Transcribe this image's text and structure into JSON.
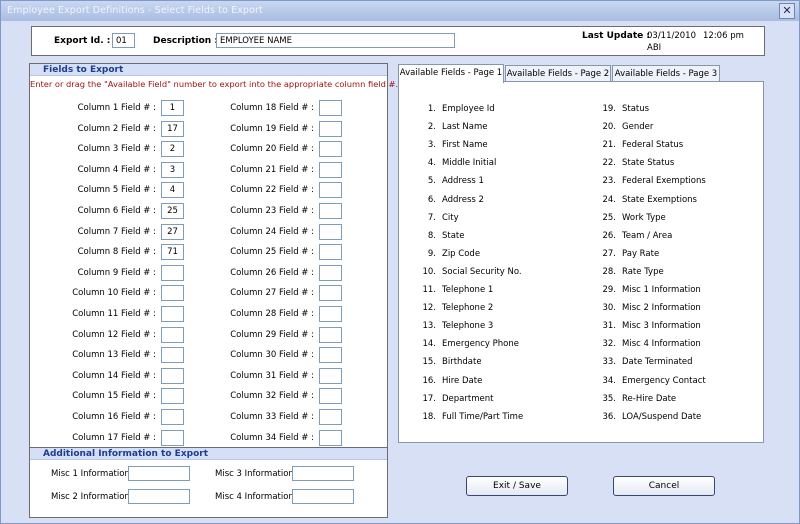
{
  "window": {
    "title": "Employee Export Definitions - Select Fields to Export",
    "close_glyph": "✕"
  },
  "header": {
    "export_id_label": "Export Id. :",
    "export_id_value": "01",
    "description_label": "Description :",
    "description_value": "EMPLOYEE NAME",
    "last_update_label": "Last Update :",
    "last_update_date": "03/11/2010",
    "last_update_time": "12:06 pm",
    "last_update_user": "ABI"
  },
  "fields_to_export": {
    "title": "Fields to Export",
    "instruction": "Enter or drag the \"Available Field\" number to export into the appropriate column field #.",
    "left_columns": [
      {
        "label": "Column 1 Field # :",
        "value": "1"
      },
      {
        "label": "Column 2 Field # :",
        "value": "17"
      },
      {
        "label": "Column 3 Field # :",
        "value": "2"
      },
      {
        "label": "Column 4 Field # :",
        "value": "3"
      },
      {
        "label": "Column 5 Field # :",
        "value": "4"
      },
      {
        "label": "Column 6 Field # :",
        "value": "25"
      },
      {
        "label": "Column 7 Field # :",
        "value": "27"
      },
      {
        "label": "Column 8 Field # :",
        "value": "71"
      },
      {
        "label": "Column 9 Field # :",
        "value": ""
      },
      {
        "label": "Column 10 Field # :",
        "value": ""
      },
      {
        "label": "Column 11 Field # :",
        "value": ""
      },
      {
        "label": "Column 12 Field # :",
        "value": ""
      },
      {
        "label": "Column 13 Field # :",
        "value": ""
      },
      {
        "label": "Column 14 Field # :",
        "value": ""
      },
      {
        "label": "Column 15 Field # :",
        "value": ""
      },
      {
        "label": "Column 16 Field # :",
        "value": ""
      },
      {
        "label": "Column 17 Field # :",
        "value": ""
      }
    ],
    "right_columns": [
      {
        "label": "Column 18 Field # :",
        "value": ""
      },
      {
        "label": "Column 19 Field # :",
        "value": ""
      },
      {
        "label": "Column 20 Field # :",
        "value": ""
      },
      {
        "label": "Column 21 Field # :",
        "value": ""
      },
      {
        "label": "Column 22 Field # :",
        "value": ""
      },
      {
        "label": "Column 23 Field # :",
        "value": ""
      },
      {
        "label": "Column 24 Field # :",
        "value": ""
      },
      {
        "label": "Column 25 Field # :",
        "value": ""
      },
      {
        "label": "Column 26 Field # :",
        "value": ""
      },
      {
        "label": "Column 27 Field # :",
        "value": ""
      },
      {
        "label": "Column 28 Field # :",
        "value": ""
      },
      {
        "label": "Column 29 Field # :",
        "value": ""
      },
      {
        "label": "Column 30 Field # :",
        "value": ""
      },
      {
        "label": "Column 31 Field # :",
        "value": ""
      },
      {
        "label": "Column 32 Field # :",
        "value": ""
      },
      {
        "label": "Column 33 Field # :",
        "value": ""
      },
      {
        "label": "Column 34 Field # :",
        "value": ""
      }
    ]
  },
  "tabs": [
    "Available Fields - Page 1",
    "Available Fields - Page 2",
    "Available Fields - Page 3"
  ],
  "available_fields": {
    "left": [
      {
        "num": "1.",
        "name": "Employee Id"
      },
      {
        "num": "2.",
        "name": "Last Name"
      },
      {
        "num": "3.",
        "name": "First Name"
      },
      {
        "num": "4.",
        "name": "Middle Initial"
      },
      {
        "num": "5.",
        "name": "Address 1"
      },
      {
        "num": "6.",
        "name": "Address 2"
      },
      {
        "num": "7.",
        "name": "City"
      },
      {
        "num": "8.",
        "name": "State"
      },
      {
        "num": "9.",
        "name": "Zip Code"
      },
      {
        "num": "10.",
        "name": "Social Security No."
      },
      {
        "num": "11.",
        "name": "Telephone 1"
      },
      {
        "num": "12.",
        "name": "Telephone 2"
      },
      {
        "num": "13.",
        "name": "Telephone 3"
      },
      {
        "num": "14.",
        "name": "Emergency Phone"
      },
      {
        "num": "15.",
        "name": "Birthdate"
      },
      {
        "num": "16.",
        "name": "Hire Date"
      },
      {
        "num": "17.",
        "name": "Department"
      },
      {
        "num": "18.",
        "name": "Full Time/Part Time"
      }
    ],
    "right": [
      {
        "num": "19.",
        "name": "Status"
      },
      {
        "num": "20.",
        "name": "Gender"
      },
      {
        "num": "21.",
        "name": "Federal Status"
      },
      {
        "num": "22.",
        "name": "State Status"
      },
      {
        "num": "23.",
        "name": "Federal Exemptions"
      },
      {
        "num": "24.",
        "name": "State Exemptions"
      },
      {
        "num": "25.",
        "name": "Work Type"
      },
      {
        "num": "26.",
        "name": "Team / Area"
      },
      {
        "num": "27.",
        "name": "Pay Rate"
      },
      {
        "num": "28.",
        "name": "Rate Type"
      },
      {
        "num": "29.",
        "name": "Misc 1 Information"
      },
      {
        "num": "30.",
        "name": "Misc 2 Information"
      },
      {
        "num": "31.",
        "name": "Misc 3 Information"
      },
      {
        "num": "32.",
        "name": "Misc 4 Information"
      },
      {
        "num": "33.",
        "name": "Date Terminated"
      },
      {
        "num": "34.",
        "name": "Emergency Contact"
      },
      {
        "num": "35.",
        "name": "Re-Hire Date"
      },
      {
        "num": "36.",
        "name": "LOA/Suspend Date"
      }
    ]
  },
  "additional_info": {
    "title": "Additional Information to Export",
    "misc1_label": "Misc 1 Information :",
    "misc1_value": "",
    "misc2_label": "Misc 2 Information :",
    "misc2_value": "",
    "misc3_label": "Misc 3 Information :",
    "misc3_value": "",
    "misc4_label": "Misc 4 Information :",
    "misc4_value": ""
  },
  "buttons": {
    "exit_save": "Exit / Save",
    "cancel": "Cancel"
  }
}
